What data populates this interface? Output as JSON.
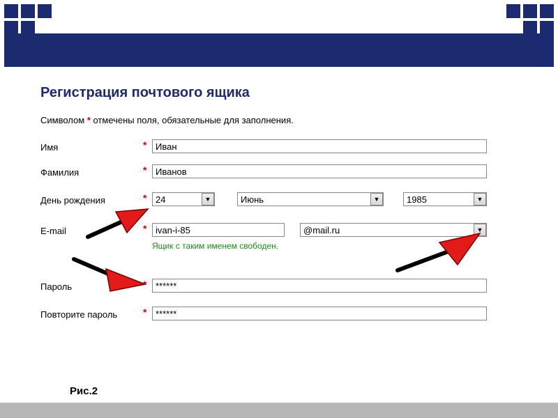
{
  "header": {
    "title": "Регистрация почтового ящика"
  },
  "note": {
    "prefix": "Символом ",
    "asterisk": "*",
    "suffix": " отмечены поля, обязательные для заполнения."
  },
  "labels": {
    "first_name": "Имя",
    "last_name": "Фамилия",
    "birthday": "День рождения",
    "email": "E-mail",
    "password": "Пароль",
    "password_repeat": "Повторите пароль"
  },
  "values": {
    "first_name": "Иван",
    "last_name": "Иванов",
    "birth_day": "24",
    "birth_month": "Июнь",
    "birth_year": "1985",
    "email_local": "ivan-i-85",
    "email_domain": "@mail.ru",
    "password": "******",
    "password_repeat": "******"
  },
  "hint": "Ящик с таким именем свободен.",
  "asterisk": "*",
  "caption": "Рис.2"
}
